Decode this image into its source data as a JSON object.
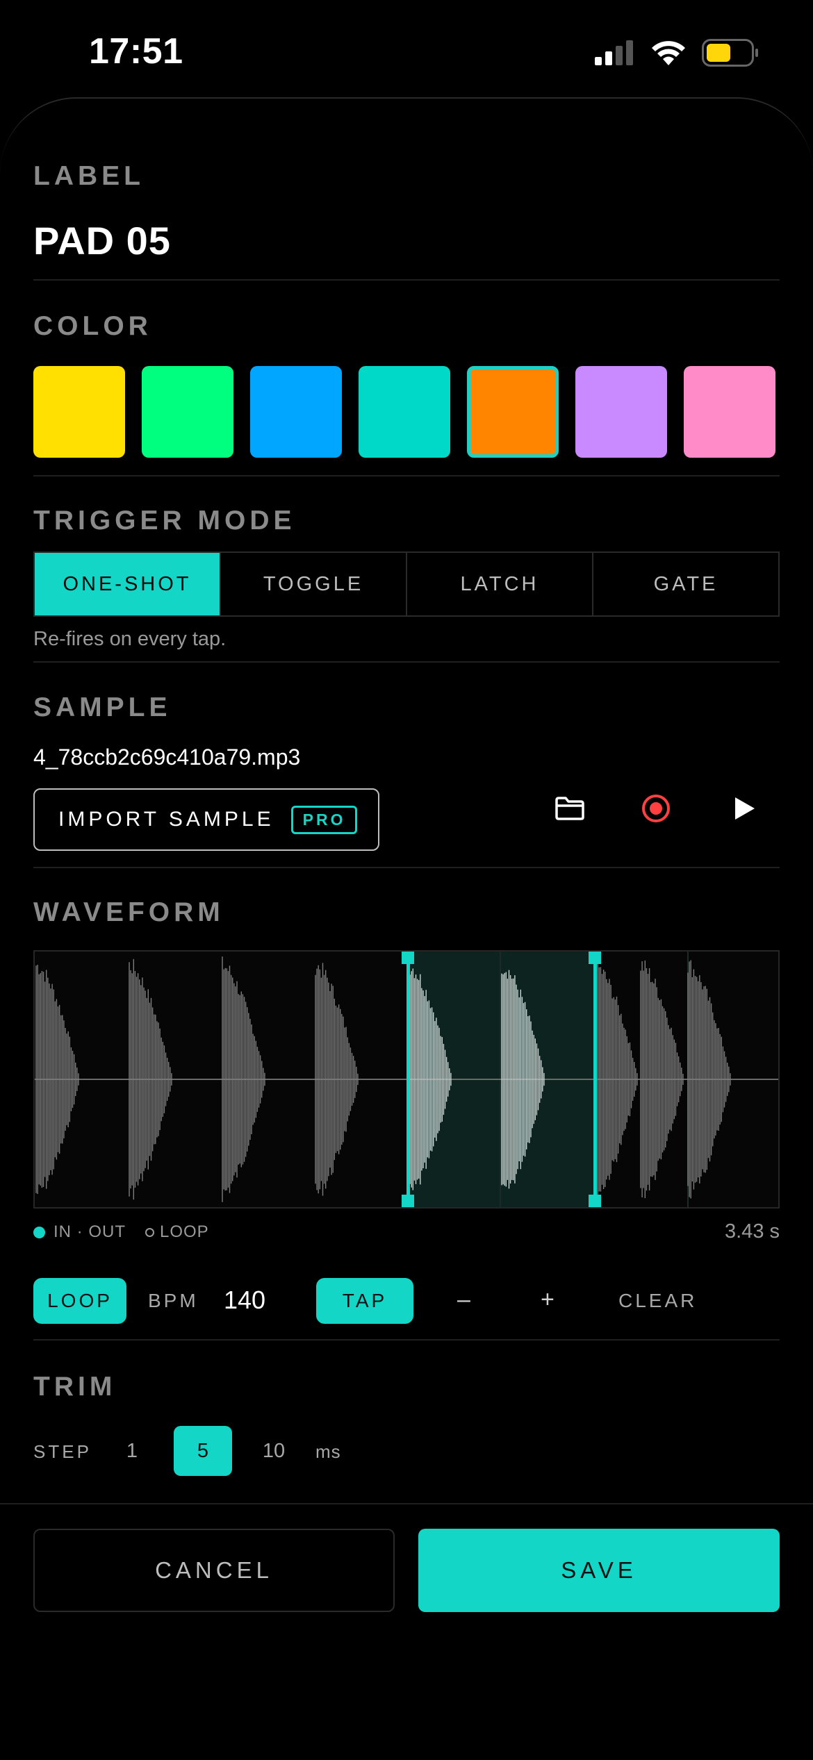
{
  "status": {
    "time": "17:51",
    "battery_color": "#ffd60a"
  },
  "label_section": {
    "title": "LABEL",
    "pad_name": "PAD 05"
  },
  "color_section": {
    "title": "COLOR",
    "swatches": [
      {
        "name": "yellow",
        "hex": "#ffe000",
        "selected": false
      },
      {
        "name": "green",
        "hex": "#00ff7f",
        "selected": false
      },
      {
        "name": "blue",
        "hex": "#00a6ff",
        "selected": false
      },
      {
        "name": "teal",
        "hex": "#00d9c8",
        "selected": false
      },
      {
        "name": "orange",
        "hex": "#ff8500",
        "selected": true
      },
      {
        "name": "violet",
        "hex": "#c98aff",
        "selected": false
      },
      {
        "name": "pink",
        "hex": "#ff8bc8",
        "selected": false
      }
    ]
  },
  "trigger_section": {
    "title": "TRIGGER MODE",
    "options": [
      "ONE-SHOT",
      "TOGGLE",
      "LATCH",
      "GATE"
    ],
    "selected": "ONE-SHOT",
    "hint": "Re-fires on every tap."
  },
  "sample_section": {
    "title": "SAMPLE",
    "filename": "4_78ccb2c69c410a79.mp3",
    "import_label": "IMPORT SAMPLE",
    "pro_badge": "PRO"
  },
  "waveform_section": {
    "title": "WAVEFORM",
    "tools": [
      "folder-icon",
      "record-icon",
      "play-icon"
    ],
    "legend_in_out": "IN · OUT",
    "legend_loop": "LOOP",
    "duration": "3.43 s"
  },
  "loop_controls": {
    "loop_label": "LOOP",
    "bpm_label": "BPM",
    "bpm_value": "140",
    "tap_label": "TAP",
    "minus_label": "–",
    "plus_label": "+",
    "clear_label": "CLEAR"
  },
  "trim_section": {
    "title": "TRIM",
    "step_label": "STEP",
    "steps": [
      "1",
      "5",
      "10"
    ],
    "selected_step": "5",
    "unit": "ms"
  },
  "footer": {
    "cancel_label": "CANCEL",
    "save_label": "SAVE"
  },
  "colors": {
    "accent": "#14d6c6",
    "record": "#ff4040"
  }
}
